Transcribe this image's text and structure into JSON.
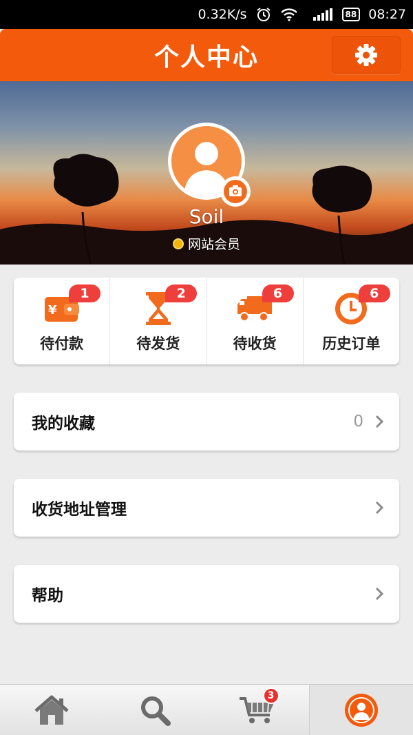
{
  "status_bar": {
    "speed": "0.32K/s",
    "battery": "88",
    "time": "08:27"
  },
  "header": {
    "title": "个人中心",
    "settings_icon": "gear-icon"
  },
  "profile": {
    "username": "Soil",
    "member_level": "网站会员"
  },
  "orders": [
    {
      "label": "待付款",
      "count": "1",
      "icon": "wallet-yen-icon"
    },
    {
      "label": "待发货",
      "count": "2",
      "icon": "hourglass-icon"
    },
    {
      "label": "待收货",
      "count": "6",
      "icon": "truck-icon"
    },
    {
      "label": "历史订单",
      "count": "6",
      "icon": "clock-icon"
    }
  ],
  "menu": {
    "favorites": {
      "label": "我的收藏",
      "count": "0"
    },
    "address": {
      "label": "收货地址管理"
    },
    "help": {
      "label": "帮助"
    }
  },
  "tabs": {
    "cart_badge": "3",
    "items": [
      "home-icon",
      "search-icon",
      "cart-icon",
      "user-icon"
    ]
  },
  "colors": {
    "accent": "#f35a0c",
    "badge": "#ef3f3c"
  }
}
